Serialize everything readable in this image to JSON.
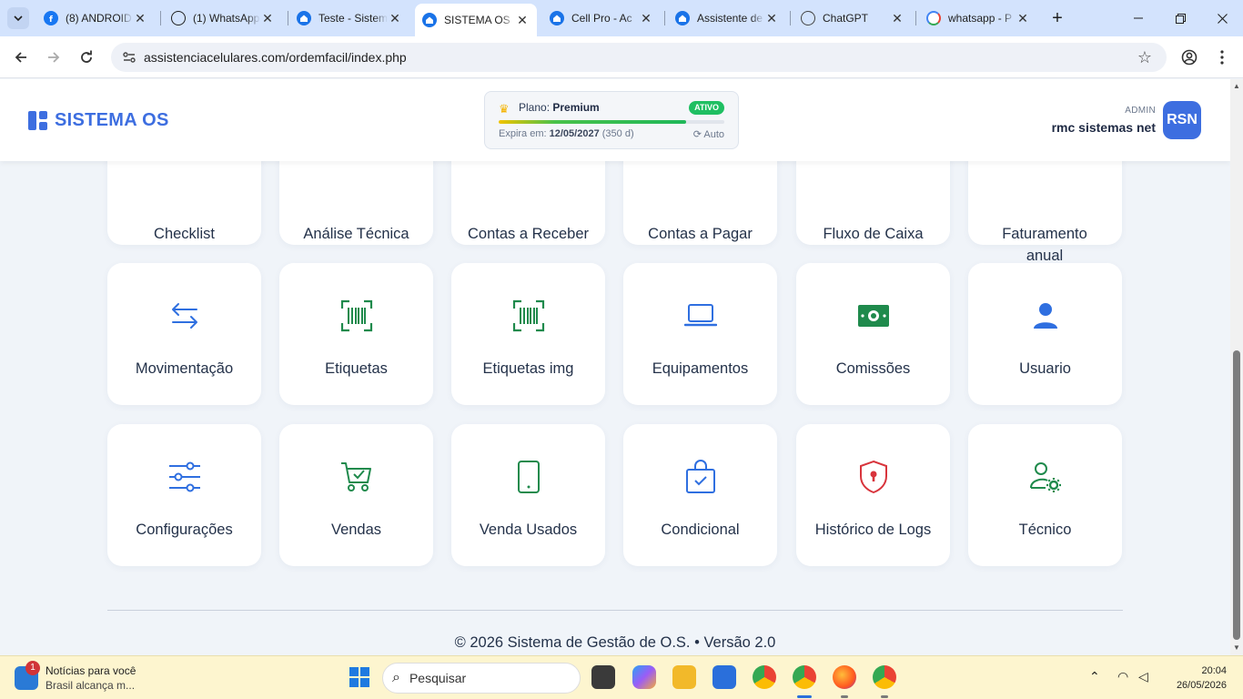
{
  "browser": {
    "tabs": [
      {
        "title": "(8) ANDROID",
        "favicon": "facebook-icon",
        "active": false
      },
      {
        "title": "(1) WhatsApp",
        "favicon": "whatsapp-icon",
        "active": false
      },
      {
        "title": "Teste - Sistem",
        "favicon": "house-icon",
        "active": false
      },
      {
        "title": "SISTEMA OS",
        "favicon": "house-icon",
        "active": true
      },
      {
        "title": "Cell Pro - Ac",
        "favicon": "house-icon",
        "active": false
      },
      {
        "title": "Assistente de",
        "favicon": "house-icon",
        "active": false
      },
      {
        "title": "ChatGPT",
        "favicon": "chatgpt-icon",
        "active": false
      },
      {
        "title": "whatsapp - P",
        "favicon": "google-icon",
        "active": false
      }
    ],
    "url": "assistenciacelulares.com/ordemfacil/index.php"
  },
  "header": {
    "brand": "SISTEMA OS",
    "plan_prefix": "Plano:",
    "plan_name": "Premium",
    "plan_status": "ATIVO",
    "plan_progress": 0.83,
    "expire_prefix": "Expira em:",
    "expire_date": "12/05/2027",
    "expire_days": "(350 d)",
    "auto_label": "Auto",
    "user_role": "ADMIN",
    "user_name": "rmc sistemas net",
    "avatar_initials": "RSN"
  },
  "modules_row1": [
    {
      "label": "Checklist"
    },
    {
      "label": "Análise Técnica"
    },
    {
      "label": "Contas a Receber"
    },
    {
      "label": "Contas a Pagar"
    },
    {
      "label": "Fluxo de Caixa"
    },
    {
      "label": "Faturamento anual"
    }
  ],
  "modules_row2": [
    {
      "label": "Movimentação",
      "icon": "arrows-exchange-icon"
    },
    {
      "label": "Etiquetas",
      "icon": "barcode-icon"
    },
    {
      "label": "Etiquetas img",
      "icon": "barcode-icon"
    },
    {
      "label": "Equipamentos",
      "icon": "laptop-icon"
    },
    {
      "label": "Comissões",
      "icon": "cash-icon"
    },
    {
      "label": "Usuario",
      "icon": "user-icon"
    }
  ],
  "modules_row3": [
    {
      "label": "Configurações",
      "icon": "sliders-icon"
    },
    {
      "label": "Vendas",
      "icon": "cart-check-icon"
    },
    {
      "label": "Venda Usados",
      "icon": "smartphone-icon"
    },
    {
      "label": "Condicional",
      "icon": "bag-check-icon"
    },
    {
      "label": "Histórico de Logs",
      "icon": "shield-lock-icon"
    },
    {
      "label": "Técnico",
      "icon": "user-gear-icon"
    }
  ],
  "footer": {
    "text": "© 2026 Sistema de Gestão de O.S. • Versão 2.0"
  },
  "taskbar": {
    "news_title": "Notícias para você",
    "news_sub": "Brasil alcança m...",
    "news_badge": "1",
    "search_placeholder": "Pesquisar",
    "time": "20:04",
    "date": "26/05/2026"
  },
  "colors": {
    "brand_blue": "#3d6ee0",
    "icon_blue": "#2f6fe0",
    "icon_green": "#1f8a4c",
    "icon_red": "#d8343c",
    "status_green": "#1fbf62"
  }
}
